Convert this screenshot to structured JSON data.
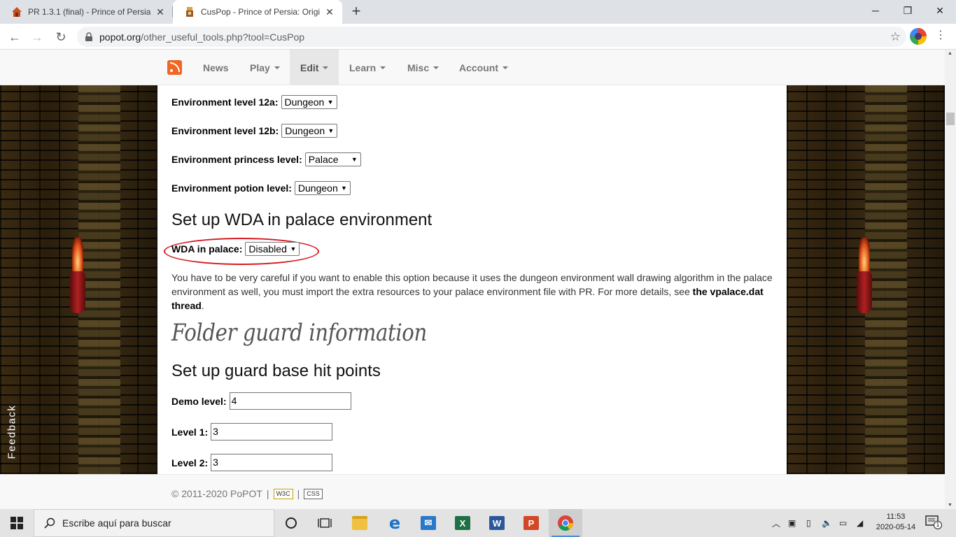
{
  "browser": {
    "tabs": [
      {
        "title": "PR 1.3.1 (final) - Prince of Persia"
      },
      {
        "title": "CusPop - Prince of Persia: Origina"
      }
    ],
    "new_tab": "+",
    "url_host": "popot.org",
    "url_path": "/other_useful_tools.php?tool=CusPop"
  },
  "site_nav": {
    "items": [
      {
        "label": "News"
      },
      {
        "label": "Play"
      },
      {
        "label": "Edit"
      },
      {
        "label": "Learn"
      },
      {
        "label": "Misc"
      },
      {
        "label": "Account"
      }
    ],
    "active": "Edit"
  },
  "feedback_tab": "Feedback",
  "content": {
    "env_12a": {
      "label": "Environment level 12a:",
      "value": "Dungeon"
    },
    "env_12b": {
      "label": "Environment level 12b:",
      "value": "Dungeon"
    },
    "env_princess": {
      "label": "Environment princess level:",
      "value": "Palace"
    },
    "env_potion": {
      "label": "Environment potion level:",
      "value": "Dungeon"
    },
    "wda_heading": "Set up WDA in palace environment",
    "wda": {
      "label": "WDA in palace:",
      "value": "Disabled"
    },
    "wda_note_text": "You have to be very careful if you want to enable this option because it uses the dungeon environment wall drawing algorithm in the palace environment as well, you must import the extra resources to your palace environment file with PR. For more details, see ",
    "wda_note_link": "the vpalace.dat thread",
    "wda_note_end": ".",
    "folder_heading": "Folder guard information",
    "hp_heading": "Set up guard base hit points",
    "demo": {
      "label": "Demo level:",
      "value": "4"
    },
    "level1": {
      "label": "Level 1:",
      "value": "3"
    },
    "level2": {
      "label": "Level 2:",
      "value": "3"
    }
  },
  "footer": {
    "copyright": "© 2011-2020 PoPOT",
    "sep": "|",
    "badge1": "W3C",
    "badge2": "CSS"
  },
  "taskbar": {
    "search_placeholder": "Escribe aquí para buscar",
    "time": "11:53",
    "date": "2020-05-14",
    "notifications": "1"
  }
}
